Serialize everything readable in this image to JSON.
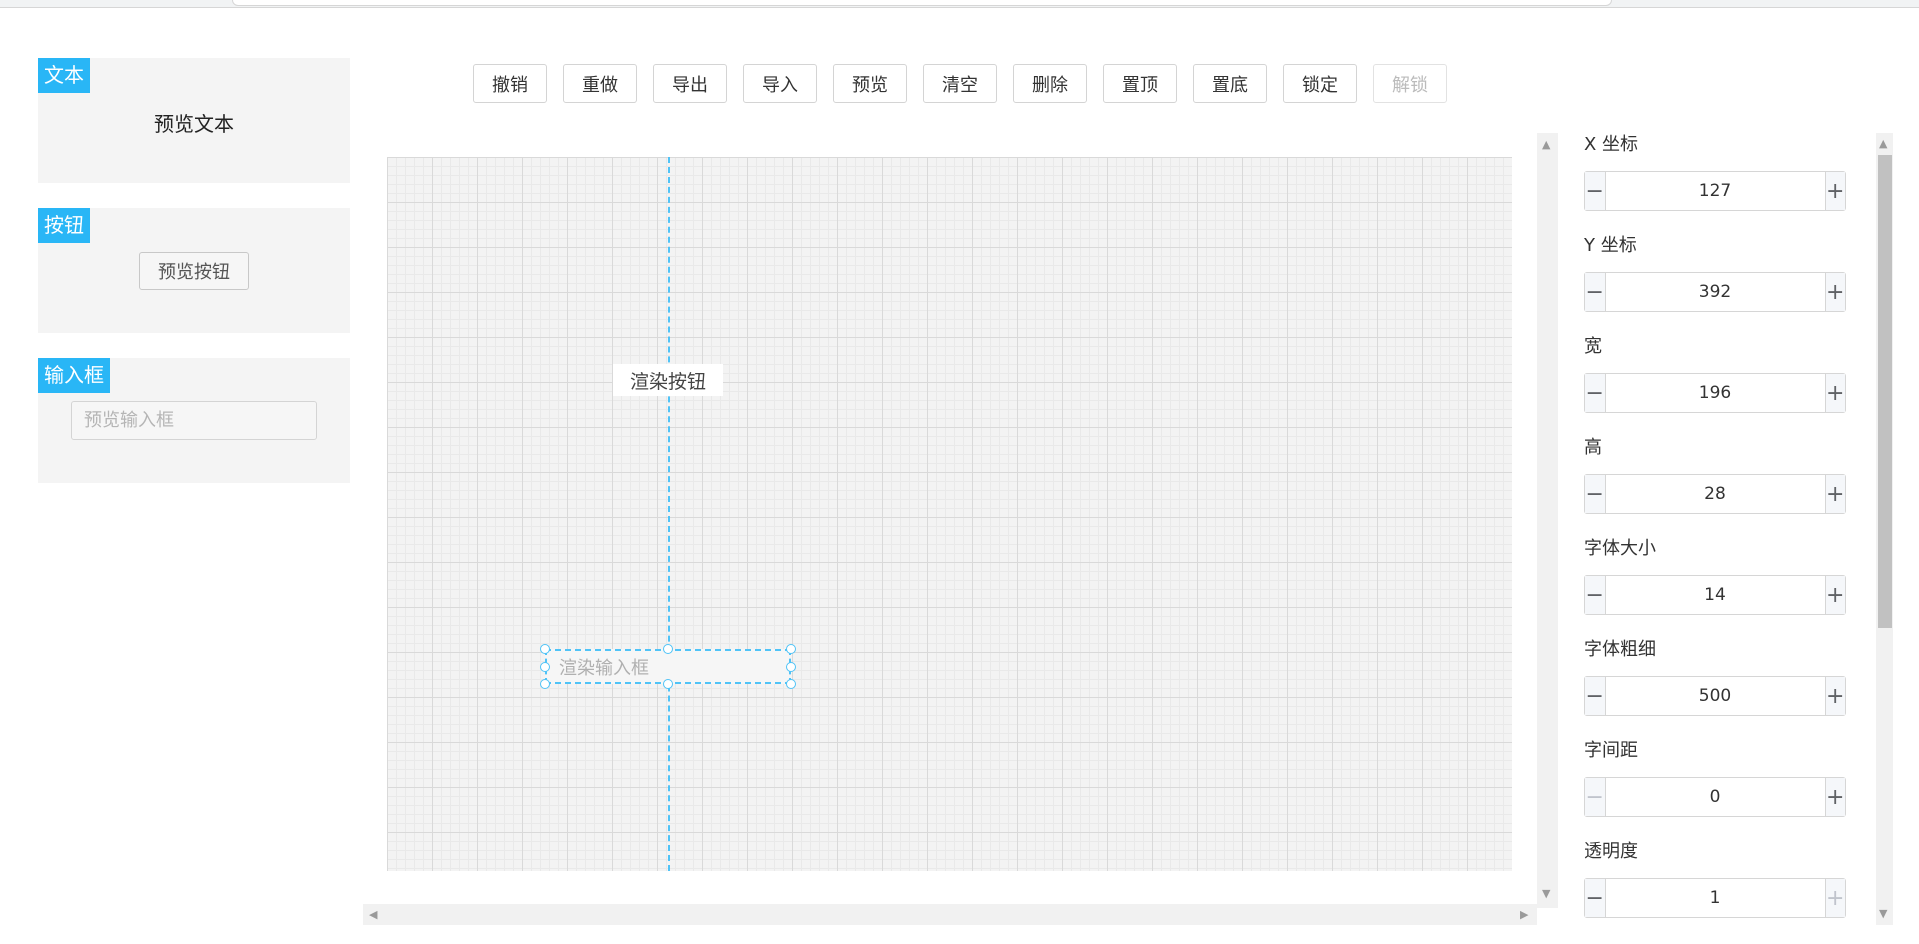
{
  "palette": {
    "text": {
      "tag": "文本",
      "preview": "预览文本"
    },
    "button": {
      "tag": "按钮",
      "preview": "预览按钮"
    },
    "input": {
      "tag": "输入框",
      "placeholder": "预览输入框"
    }
  },
  "toolbar": {
    "undo": "撤销",
    "redo": "重做",
    "export": "导出",
    "import": "导入",
    "preview": "预览",
    "clear": "清空",
    "delete": "删除",
    "to_top": "置顶",
    "to_bottom": "置底",
    "lock": "锁定",
    "unlock": "解锁"
  },
  "canvas": {
    "render_button": "渲染按钮",
    "render_input_placeholder": "渲染输入框",
    "guide_color": "#4fc3f7"
  },
  "properties": [
    {
      "label": "X 坐标",
      "value": "127"
    },
    {
      "label": "Y 坐标",
      "value": "392"
    },
    {
      "label": "宽",
      "value": "196"
    },
    {
      "label": "高",
      "value": "28"
    },
    {
      "label": "字体大小",
      "value": "14"
    },
    {
      "label": "字体粗细",
      "value": "500"
    },
    {
      "label": "字间距",
      "value": "0"
    },
    {
      "label": "透明度",
      "value": "1"
    }
  ],
  "icons": {
    "decrement": "−",
    "increment": "+",
    "arrow_up": "▲",
    "arrow_down": "▼",
    "arrow_left": "◀",
    "arrow_right": "▶"
  },
  "colors": {
    "accent": "#29b6f6"
  }
}
